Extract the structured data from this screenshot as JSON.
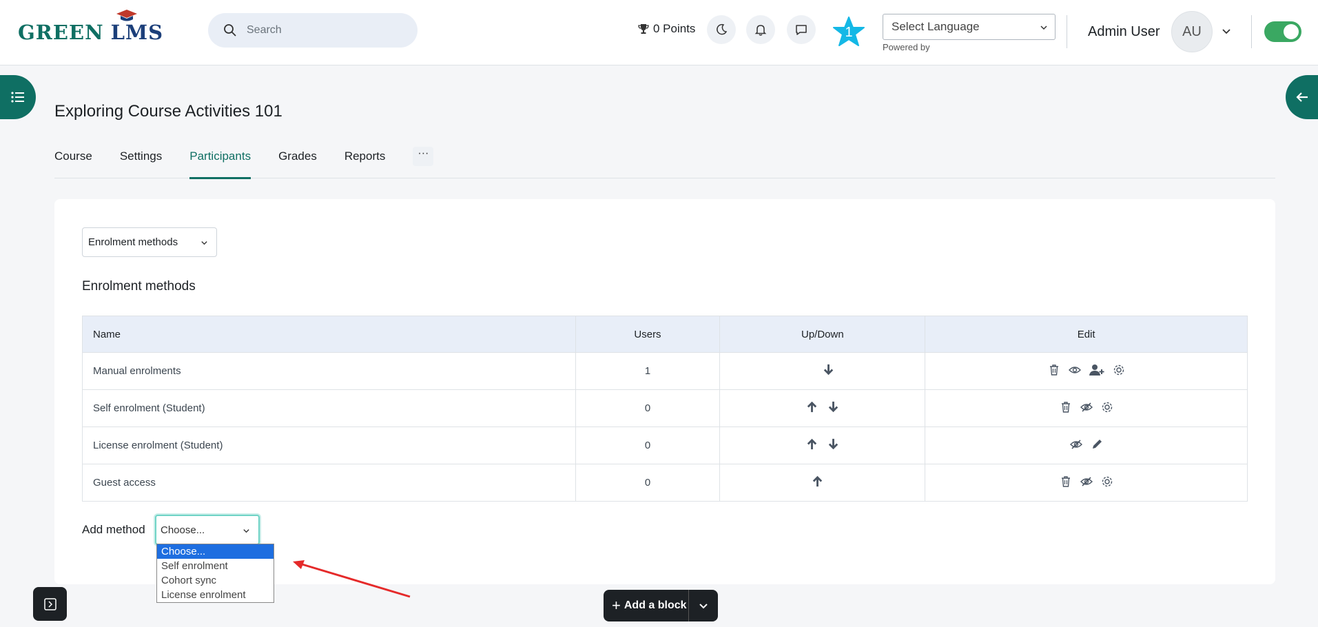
{
  "header": {
    "logo_text_green": "GREEN",
    "logo_text_lms": "LMS",
    "search_placeholder": "Search",
    "points": "0 Points",
    "notification_count": "1",
    "language_select": "Select Language",
    "powered_by": "Powered by",
    "user_name": "Admin User",
    "avatar_initials": "AU"
  },
  "page": {
    "title": "Exploring Course Activities 101",
    "tabs": [
      "Course",
      "Settings",
      "Participants",
      "Grades",
      "Reports"
    ],
    "active_tab": "Participants",
    "more_tab": "···"
  },
  "content": {
    "nav_select_value": "Enrolment methods",
    "section_title": "Enrolment methods",
    "table": {
      "headers": [
        "Name",
        "Users",
        "Up/Down",
        "Edit"
      ],
      "rows": [
        {
          "name": "Manual enrolments",
          "users": "1"
        },
        {
          "name": "Self enrolment (Student)",
          "users": "0"
        },
        {
          "name": "License enrolment (Student)",
          "users": "0"
        },
        {
          "name": "Guest access",
          "users": "0"
        }
      ]
    },
    "add_method_label": "Add method",
    "add_method_value": "Choose...",
    "add_method_options": [
      "Choose...",
      "Self enrolment",
      "Cohort sync",
      "License enrolment"
    ]
  },
  "footer": {
    "add_block_label": "Add a block",
    "add_block_plus": "+"
  },
  "colors": {
    "brand": "#0f6f63",
    "highlight": "#1e6ee0",
    "annotation": "#e52a2a"
  }
}
